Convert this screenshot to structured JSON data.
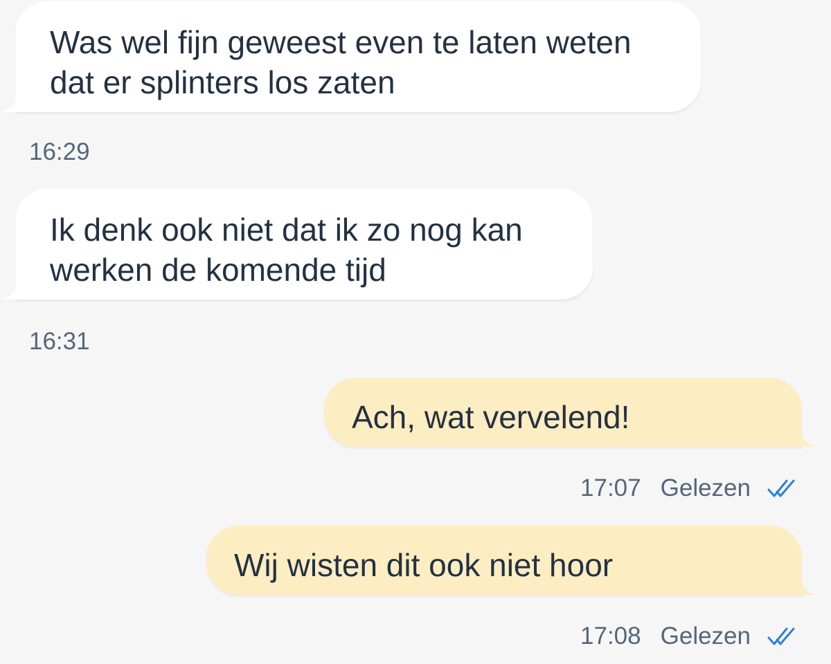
{
  "colors": {
    "background": "#f6f6f7",
    "incoming_bubble": "#ffffff",
    "outgoing_bubble": "#fdedc2",
    "text": "#243142",
    "meta_text": "#55667a",
    "read_check": "#2f7fd6"
  },
  "messages": [
    {
      "direction": "incoming",
      "text": "Was wel fijn geweest even te laten weten\ndat er splinters los zaten",
      "time": "16:29"
    },
    {
      "direction": "incoming",
      "text": "Ik denk ook niet dat ik zo nog kan\nwerken de komende tijd",
      "time": "16:31"
    },
    {
      "direction": "outgoing",
      "text": "Ach, wat vervelend!",
      "time": "17:07",
      "status": "Gelezen",
      "status_icon": "double-check-icon"
    },
    {
      "direction": "outgoing",
      "text": "Wij wisten dit ook niet hoor",
      "time": "17:08",
      "status": "Gelezen",
      "status_icon": "double-check-icon"
    }
  ]
}
